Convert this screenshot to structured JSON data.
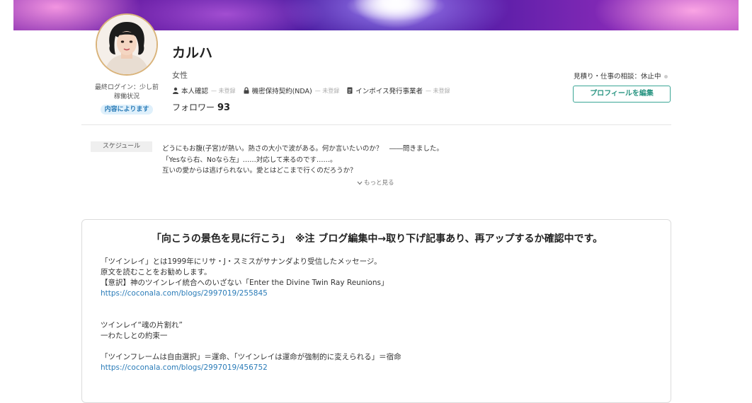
{
  "profile": {
    "name": "カルハ",
    "gender": "女性",
    "last_login": "最終ログイン：少し前",
    "activity_label": "稼働状況",
    "activity_status": "内容によります",
    "followers_label": "フォロワー",
    "followers_count": "93",
    "verifications": [
      {
        "label": "本人確認",
        "state": "— 未登録",
        "icon": "person-icon"
      },
      {
        "label": "機密保持契約(NDA)",
        "state": "— 未登録",
        "icon": "lock-icon"
      },
      {
        "label": "インボイス発行事業者",
        "state": "— 未登録",
        "icon": "document-icon"
      }
    ]
  },
  "side": {
    "consult_status": "見積り・仕事の相談：休止中",
    "edit_button": "プロフィールを編集"
  },
  "schedule": {
    "tag": "スケジュール",
    "lines": [
      "どうにもお腹(子宮)が熱い。熱さの大小で波がある。何か言いたいのか？　――問きました。",
      "「Yesなら右、Noなら左」……対応して来るのです……。",
      "互いの愛からは逃げられない。愛とはどこまで行くのだろうか？"
    ],
    "more": "もっと見る"
  },
  "article": {
    "title": "「向こうの景色を見に行こう」　※注 ブログ編集中→取り下げ記事あり、再アップするか確認中です。",
    "lines": [
      "「ツインレイ」とは1999年にリサ・J・スミスがサナンダより受信したメッセージ。",
      "原文を読むことをお勧めします。",
      "【意訳】神のツインレイ統合へのいざない「Enter the Divine Twin Ray Reunions」",
      "https://coconala.com/blogs/2997019/255845",
      "ツインレイ“魂の片割れ”",
      "一わたしとの約束一",
      "「ツインフレームは自由選択」＝運命、「ツインレイは運命が強制的に変えられる」＝宿命",
      "https://coconala.com/blogs/2997019/456752"
    ]
  },
  "colors": {
    "accent": "#2a9582",
    "link": "#2b7cb8",
    "badge_bg": "#dff0fb"
  }
}
